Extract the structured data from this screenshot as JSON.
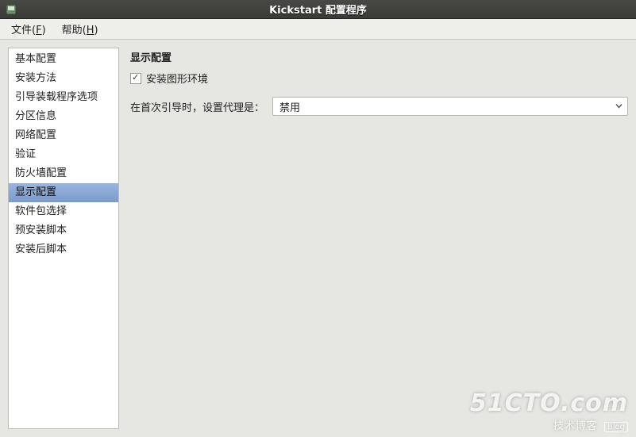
{
  "window": {
    "title": "Kickstart 配置程序"
  },
  "menubar": {
    "items": [
      {
        "label": "文件",
        "accel": "F"
      },
      {
        "label": "帮助",
        "accel": "H"
      }
    ]
  },
  "sidebar": {
    "items": [
      {
        "label": "基本配置",
        "selected": false
      },
      {
        "label": "安装方法",
        "selected": false
      },
      {
        "label": "引导装载程序选项",
        "selected": false
      },
      {
        "label": "分区信息",
        "selected": false
      },
      {
        "label": "网络配置",
        "selected": false
      },
      {
        "label": "验证",
        "selected": false
      },
      {
        "label": "防火墙配置",
        "selected": false
      },
      {
        "label": "显示配置",
        "selected": true
      },
      {
        "label": "软件包选择",
        "selected": false
      },
      {
        "label": "预安装脚本",
        "selected": false
      },
      {
        "label": "安装后脚本",
        "selected": false
      }
    ]
  },
  "main": {
    "section_title": "显示配置",
    "install_gui_checkbox": {
      "label": "安装图形环境",
      "checked": true
    },
    "firstboot_label": "在首次引导时，设置代理是：",
    "firstboot_select": {
      "value": "禁用"
    }
  },
  "watermark": {
    "main": "51CTO.com",
    "sub": "技术博客",
    "blog": "Blog"
  }
}
